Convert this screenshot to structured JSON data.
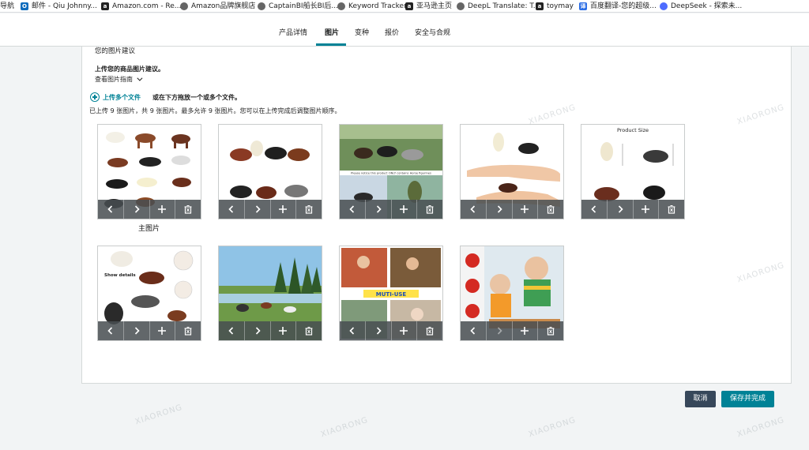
{
  "bookmarks": [
    {
      "label": "导航",
      "icon": "none"
    },
    {
      "label": "邮件 - Qiu Johnny...",
      "icon": "outlook-icon",
      "color": "#0f6cbd"
    },
    {
      "label": "Amazon.com - Re...",
      "icon": "amazon-icon",
      "color": "#222222"
    },
    {
      "label": "Amazon品牌旗舰店",
      "icon": "globe-icon",
      "color": "#555555"
    },
    {
      "label": "CaptainBI船长BI后...",
      "icon": "globe-icon",
      "color": "#555555"
    },
    {
      "label": "Keyword Tracker",
      "icon": "globe-icon",
      "color": "#555555"
    },
    {
      "label": "亚马逊主页",
      "icon": "amazon-icon",
      "color": "#222222"
    },
    {
      "label": "DeepL Translate: T...",
      "icon": "globe-icon",
      "color": "#555555"
    },
    {
      "label": "toymay",
      "icon": "amazon-icon",
      "color": "#222222"
    },
    {
      "label": "百度翻译-您的超级...",
      "icon": "baidu-icon",
      "color": "#2b6de5"
    },
    {
      "label": "DeepSeek - 探索未...",
      "icon": "deepseek-icon",
      "color": "#4d6bfe"
    }
  ],
  "tabs": [
    {
      "label": "产品详情",
      "active": false
    },
    {
      "label": "图片",
      "active": true
    },
    {
      "label": "变种",
      "active": false
    },
    {
      "label": "报价",
      "active": false
    },
    {
      "label": "安全与合规",
      "active": false
    }
  ],
  "images_section": {
    "suggestion_title": "您的图片建议",
    "upload_prompt": "上传您的商品图片建议。",
    "guide_link": "查看图片指南",
    "upload_multiple": "上传多个文件",
    "drag_hint": "或在下方拖放一个或多个文件。",
    "status": "已上传 9 张图片，共 9 张图片。最多允许 9 张图片。您可以在上传完成后调整图片顺序。",
    "main_image_label": "主图片",
    "thumbnails": [
      {
        "caption": ""
      },
      {
        "caption": ""
      },
      {
        "caption": "Please notice this product ONLY contains Horse figurines"
      },
      {
        "caption": ""
      },
      {
        "caption": "Product Size"
      },
      {
        "caption": "Show details"
      },
      {
        "caption": ""
      },
      {
        "caption": "MUTI-USE"
      },
      {
        "caption": ""
      }
    ]
  },
  "footer": {
    "cancel_label": "取消",
    "save_label": "保存并完成"
  },
  "watermark": "XIAORONG",
  "colors": {
    "accent": "#008296",
    "cancel_bg": "#37475a",
    "toolbar_bg": "#484e52"
  }
}
